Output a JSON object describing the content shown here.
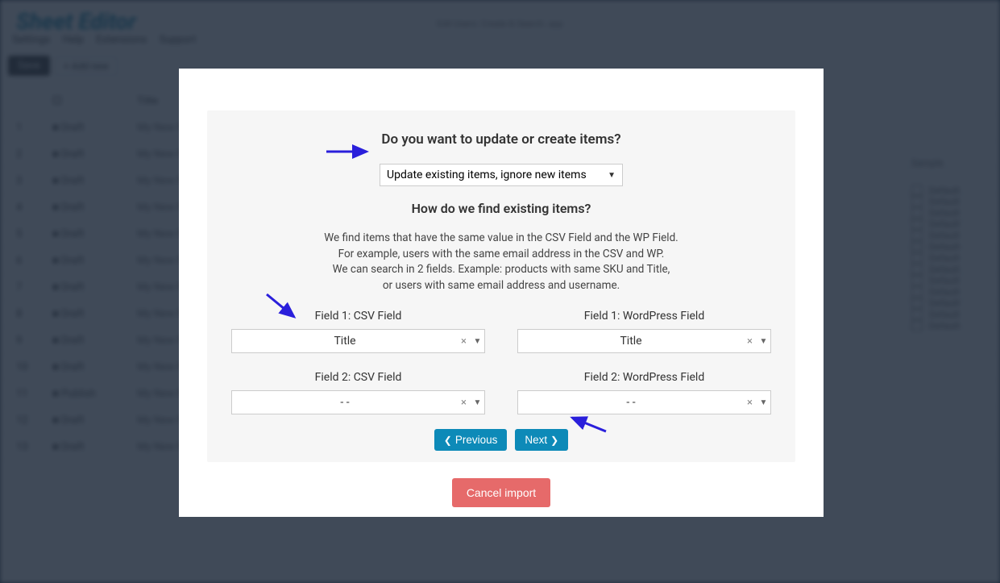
{
  "bg": {
    "logo": "Sheet Editor",
    "title_bubble": "Edit Users: Create & Search. app",
    "links": [
      "Settings",
      "Help",
      "Extensions",
      "Support"
    ],
    "save": "Save",
    "add": "Add new",
    "th_title": "Title",
    "rows": [
      {
        "status": "Draft",
        "title": "My New Post"
      },
      {
        "status": "Draft",
        "title": "My New Post"
      },
      {
        "status": "Draft",
        "title": "My New Post"
      },
      {
        "status": "Draft",
        "title": "My New Post"
      },
      {
        "status": "Draft",
        "title": "My New Post"
      },
      {
        "status": "Draft",
        "title": "My New Post"
      },
      {
        "status": "Draft",
        "title": "My New Post"
      },
      {
        "status": "Draft",
        "title": "My New Post"
      },
      {
        "status": "Draft",
        "title": "My New Post"
      },
      {
        "status": "Draft",
        "title": "My New Post"
      },
      {
        "status": "Publish",
        "title": "My New Post"
      },
      {
        "status": "Draft",
        "title": "My New Post"
      },
      {
        "status": "Draft",
        "title": "My New Post"
      }
    ],
    "right_header": "Sample",
    "right_item": "Default"
  },
  "modal": {
    "heading": "Do you want to update or create items?",
    "select_value": "Update existing items, ignore new items",
    "sub_heading": "How do we find existing items?",
    "desc_l1": "We find items that have the same value in the CSV Field and the WP Field.",
    "desc_l2": "For example, users with the same email address in the CSV and WP.",
    "desc_l3": "We can search in 2 fields. Example: products with same SKU and Title,",
    "desc_l4": "or users with same email address and username.",
    "fields": {
      "csv1_label": "Field 1: CSV Field",
      "csv1_value": "Title",
      "wp1_label": "Field 1: WordPress Field",
      "wp1_value": "Title",
      "csv2_label": "Field 2: CSV Field",
      "csv2_value": "- -",
      "wp2_label": "Field 2: WordPress Field",
      "wp2_value": "- -"
    },
    "prev": "Previous",
    "next": "Next",
    "cancel": "Cancel import"
  }
}
